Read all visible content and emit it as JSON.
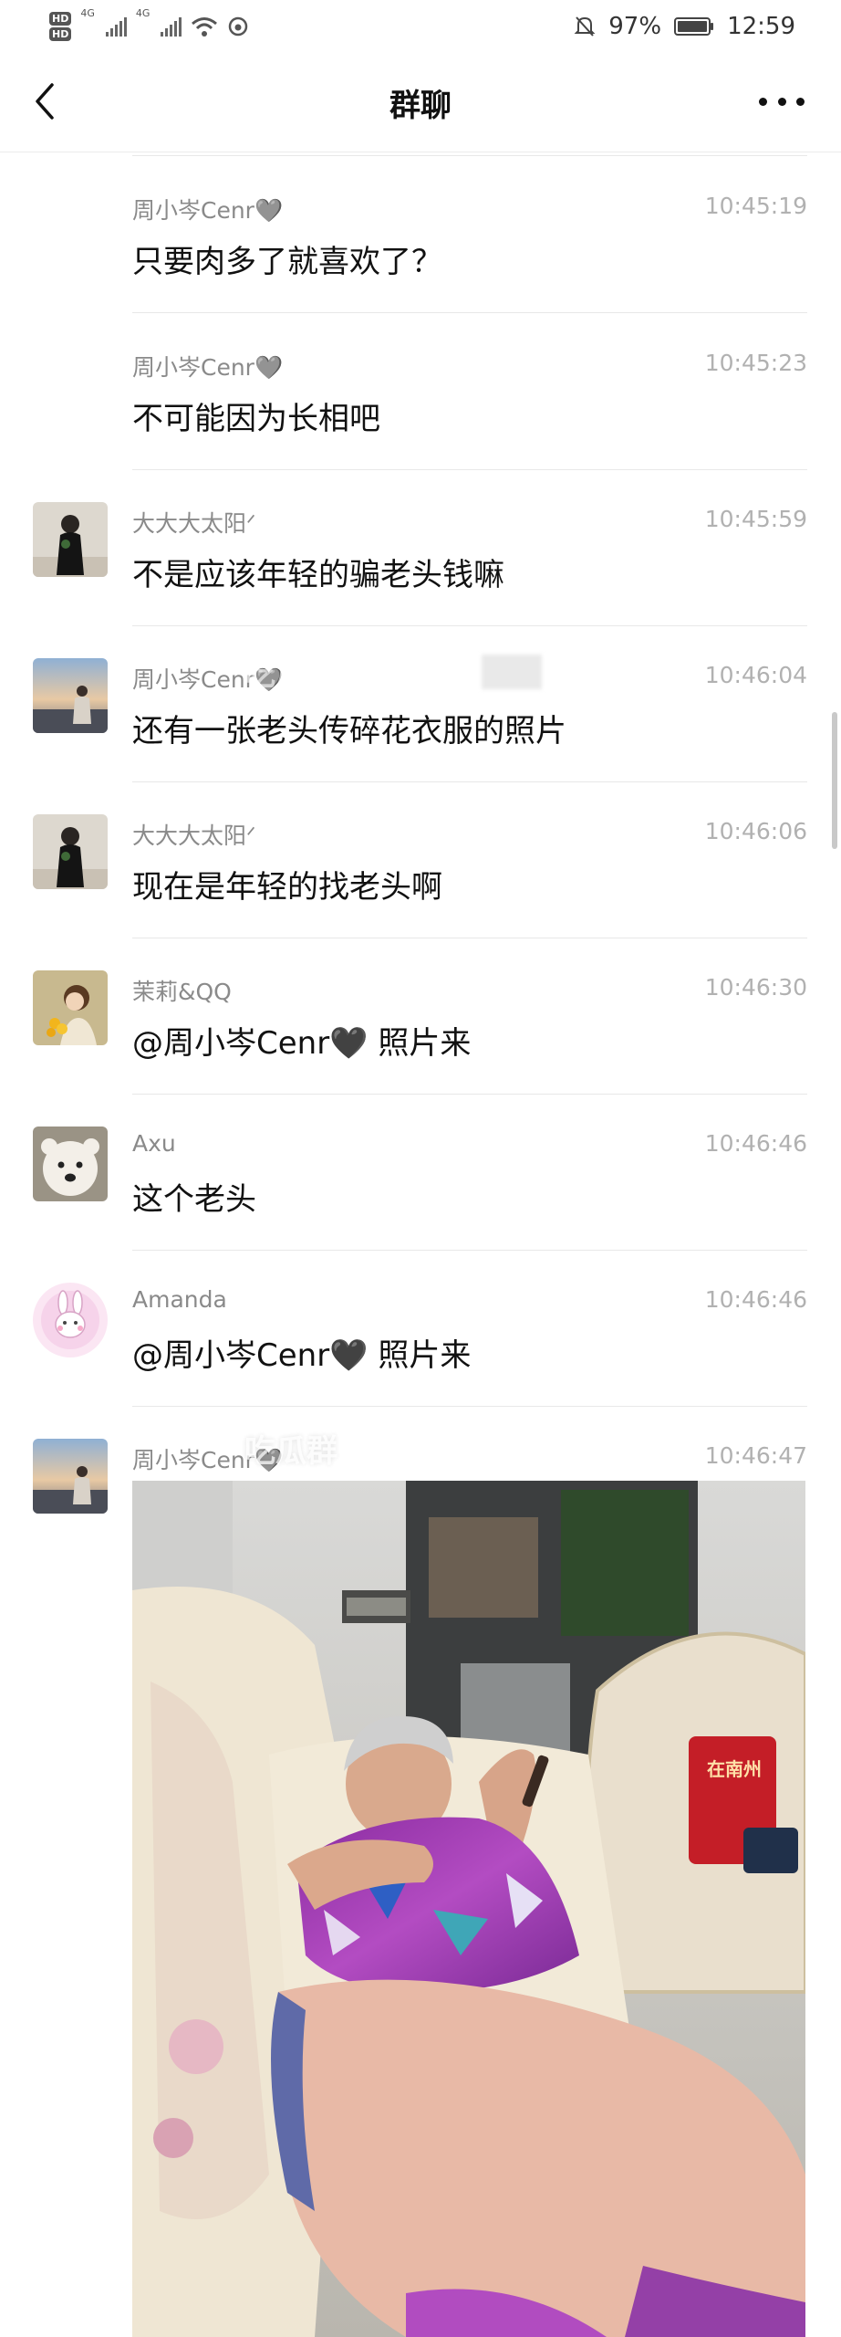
{
  "status_bar": {
    "hd1": "HD",
    "hd2": "HD",
    "net1": "4G",
    "net2": "4G",
    "battery": "97%",
    "time": "12:59",
    "icons": [
      "signal-icon",
      "wifi-icon",
      "mute-icon",
      "battery-icon"
    ]
  },
  "header": {
    "title": "群聊",
    "back_icon": "chevron-left-icon",
    "more_icon": "more-dots-icon"
  },
  "messages": [
    {
      "sender": "周小岑Cenr🩶",
      "time": "10:45:19",
      "text": "只要肉多了就喜欢了？",
      "avatar": "none"
    },
    {
      "sender": "周小岑Cenr🩶",
      "time": "10:45:23",
      "text": "不可能因为长相吧",
      "avatar": "none"
    },
    {
      "sender": "大大大太阳ᐟ",
      "time": "10:45:59",
      "text": "不是应该年轻的骗老头钱嘛",
      "avatar": "woman-black-dress"
    },
    {
      "sender": "周小岑Cenr🩶",
      "time": "10:46:04",
      "text": "还有一张老头传碎花衣服的照片",
      "avatar": "sunset-woman"
    },
    {
      "sender": "大大大太阳ᐟ",
      "time": "10:46:06",
      "text": "现在是年轻的找老头啊",
      "avatar": "woman-black-dress"
    },
    {
      "sender": "茉莉&QQ",
      "time": "10:46:30",
      "text": "@周小岑Cenr🖤 照片来",
      "avatar": "girl-flowers"
    },
    {
      "sender": "Axu",
      "time": "10:46:46",
      "text": "这个老头",
      "avatar": "white-dog"
    },
    {
      "sender": "Amanda",
      "time": "10:46:46",
      "text": "@周小岑Cenr🖤 照片来",
      "avatar": "pink-bunny"
    },
    {
      "sender": "周小岑Cenr🩶",
      "time": "10:46:47",
      "text": "",
      "avatar": "sunset-woman"
    }
  ],
  "watermarks": [
    "吃瓜",
    "吃瓜群"
  ],
  "photo_bag_text": "在南州",
  "colors": {
    "sender": "#8a8a8a",
    "time": "#b1b1b1",
    "text": "#111111",
    "divider": "#e8e8e8"
  }
}
